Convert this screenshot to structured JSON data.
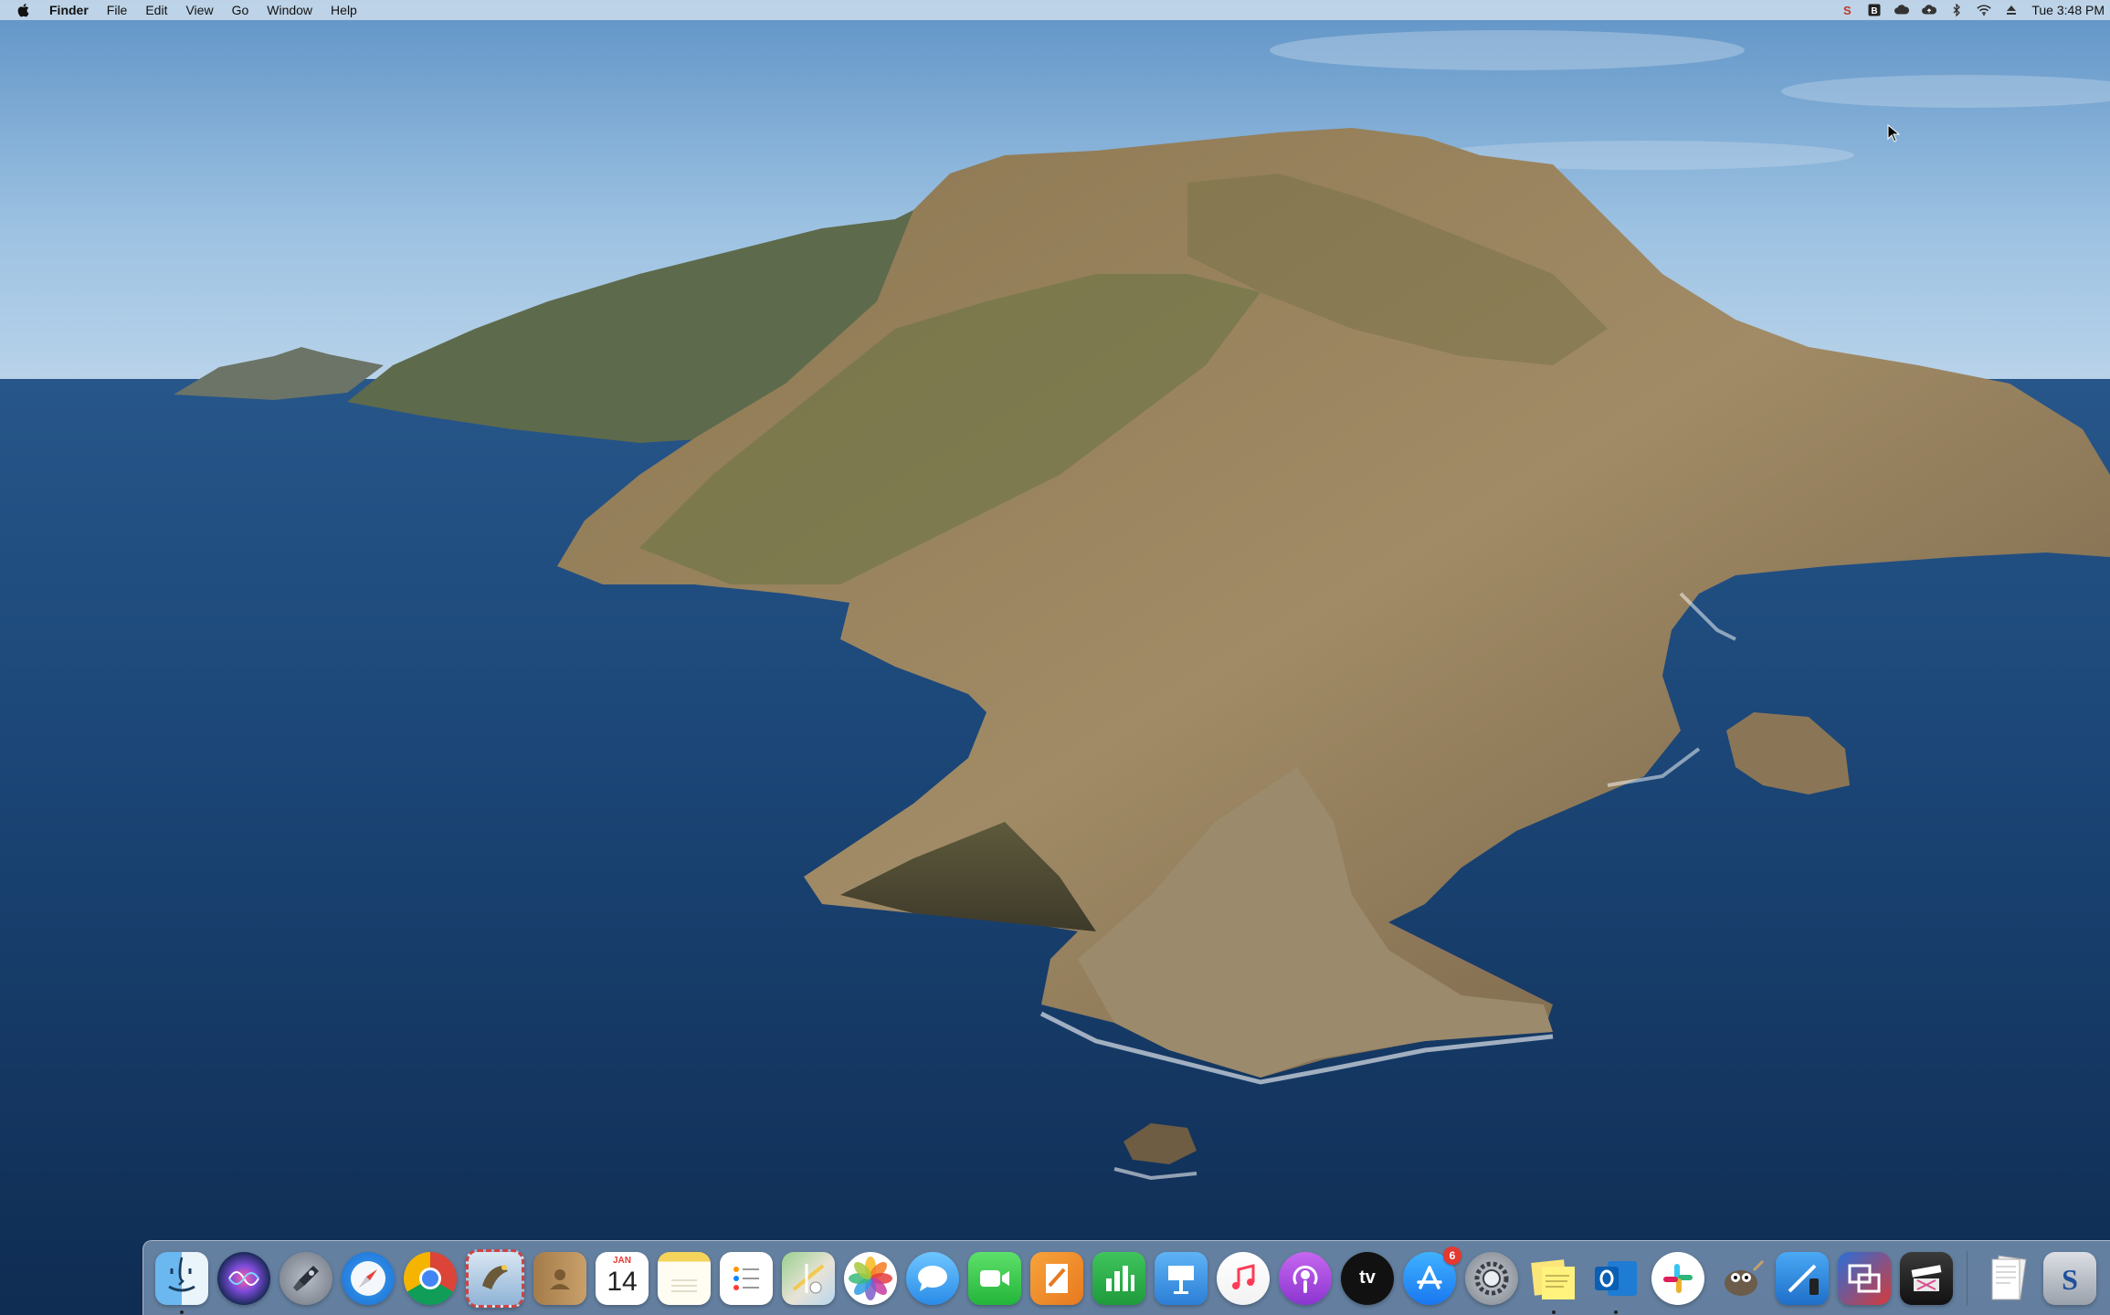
{
  "menubar": {
    "app_name": "Finder",
    "menus": [
      "File",
      "Edit",
      "View",
      "Go",
      "Window",
      "Help"
    ],
    "status_icons": [
      "scrivener-icon",
      "bbedit-icon",
      "creative-cloud-icon",
      "cloud-upload-icon",
      "bluetooth-icon",
      "wifi-icon",
      "eject-icon"
    ],
    "clock": "Tue 3:48 PM"
  },
  "dock": {
    "apps": [
      {
        "name": "Finder",
        "icon": "finder-icon",
        "running": true
      },
      {
        "name": "Siri",
        "icon": "siri-icon",
        "running": false
      },
      {
        "name": "Launchpad",
        "icon": "launchpad-icon",
        "running": false
      },
      {
        "name": "Safari",
        "icon": "safari-icon",
        "running": false
      },
      {
        "name": "Google Chrome",
        "icon": "chrome-icon",
        "running": false
      },
      {
        "name": "Mail",
        "icon": "mail-icon",
        "running": false
      },
      {
        "name": "Contacts",
        "icon": "contacts-icon",
        "running": false
      },
      {
        "name": "Calendar",
        "icon": "calendar-icon",
        "running": false,
        "month": "JAN",
        "day": "14"
      },
      {
        "name": "Notes",
        "icon": "notes-icon",
        "running": false
      },
      {
        "name": "Reminders",
        "icon": "reminders-icon",
        "running": false
      },
      {
        "name": "Maps",
        "icon": "maps-icon",
        "running": false
      },
      {
        "name": "Photos",
        "icon": "photos-icon",
        "running": false
      },
      {
        "name": "Messages",
        "icon": "messages-icon",
        "running": false
      },
      {
        "name": "FaceTime",
        "icon": "facetime-icon",
        "running": false
      },
      {
        "name": "Pages",
        "icon": "pages-icon",
        "running": false
      },
      {
        "name": "Numbers",
        "icon": "numbers-icon",
        "running": false
      },
      {
        "name": "Keynote",
        "icon": "keynote-icon",
        "running": false
      },
      {
        "name": "Music",
        "icon": "music-icon",
        "running": false
      },
      {
        "name": "Podcasts",
        "icon": "podcasts-icon",
        "running": false
      },
      {
        "name": "TV",
        "icon": "tv-icon",
        "running": false,
        "label": "tv"
      },
      {
        "name": "App Store",
        "icon": "app-store-icon",
        "running": false,
        "badge": "6"
      },
      {
        "name": "System Preferences",
        "icon": "system-preferences-icon",
        "running": false
      },
      {
        "name": "Stickies",
        "icon": "stickies-icon",
        "running": true
      },
      {
        "name": "Microsoft Outlook",
        "icon": "outlook-icon",
        "running": true
      },
      {
        "name": "Slack",
        "icon": "slack-icon",
        "running": false
      },
      {
        "name": "GIMP",
        "icon": "gimp-icon",
        "running": false
      },
      {
        "name": "Xcode",
        "icon": "xcode-icon",
        "running": false
      },
      {
        "name": "Screens",
        "icon": "screens-icon",
        "running": false
      },
      {
        "name": "Final Cut Pro",
        "icon": "final-cut-pro-icon",
        "running": false
      }
    ],
    "others": [
      {
        "name": "Documents",
        "icon": "documents-stack-icon"
      },
      {
        "name": "Scrivener",
        "icon": "scrivener-dock-icon"
      }
    ]
  }
}
